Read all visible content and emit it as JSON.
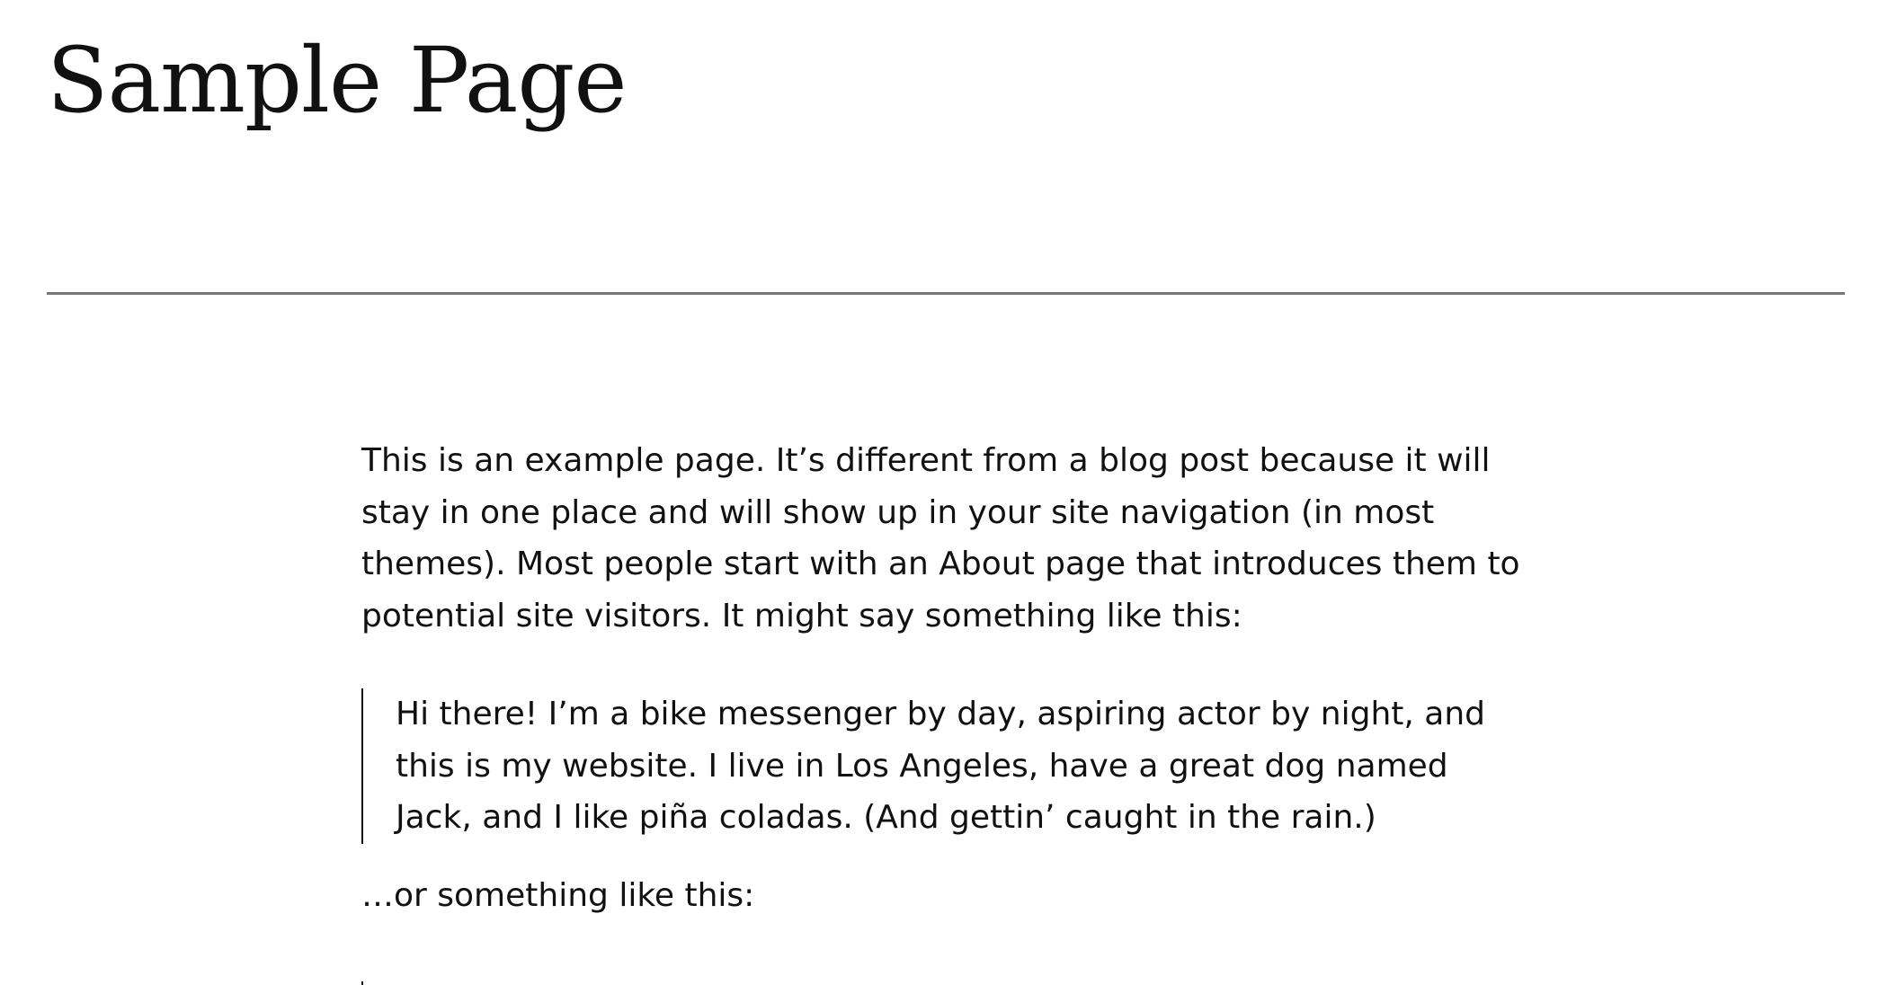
{
  "page": {
    "title": "Sample Page"
  },
  "content": {
    "intro": "This is an example page. It’s different from a blog post because it will stay in one place and will show up in your site navigation (in most themes). Most people start with an About page that introduces them to potential site visitors. It might say something like this:",
    "quote_1": "Hi there! I’m a bike messenger by day, aspiring actor by night, and this is my website. I live in Los Angeles, have a great dog named Jack, and I like piña coladas. (And gettin’ caught in the rain.)",
    "transition": "…or something like this:"
  }
}
